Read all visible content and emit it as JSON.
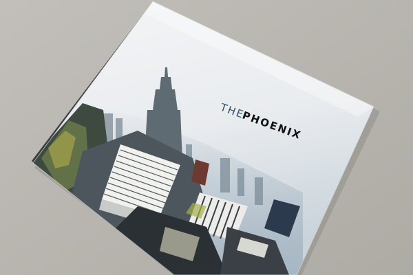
{
  "book": {
    "title_prefix": "THE",
    "title_main": "PHOENIX"
  },
  "colors": {
    "background": "#b9b6b0",
    "cover_sky": "#eef0f2",
    "title_prefix": "#2f5468",
    "title_main": "#111111",
    "city_dark": "#2b3035",
    "city_mid": "#5a646b"
  }
}
